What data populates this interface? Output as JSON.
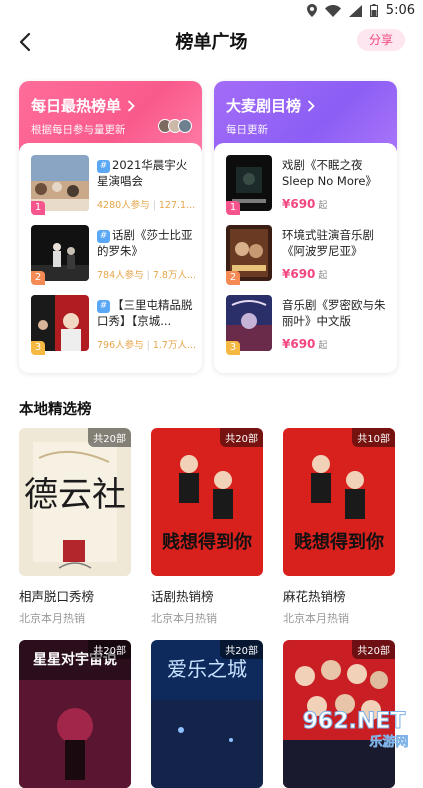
{
  "status_bar": {
    "time": "5:06"
  },
  "header": {
    "title": "榜单广场",
    "share_label": "分享"
  },
  "daily_hot": {
    "title": "每日最热榜单",
    "subtitle": "根据每日参与量更新",
    "items": [
      {
        "rank": "1",
        "name": "2021华晨宇火星演唱会",
        "participants": "4280人参与",
        "extra": "127.1..."
      },
      {
        "rank": "2",
        "name": "话剧《莎士比亚的罗朱》",
        "participants": "784人参与",
        "extra": "7.8万人..."
      },
      {
        "rank": "3",
        "name": "【三里屯精品脱口秀】【京城...",
        "participants": "796人参与",
        "extra": "1.7万人..."
      }
    ]
  },
  "musical": {
    "title": "大麦剧目榜",
    "subtitle": "每日更新",
    "items": [
      {
        "rank": "1",
        "name": "戏剧《不眠之夜Sleep No More》",
        "price": "¥690",
        "unit": "起"
      },
      {
        "rank": "2",
        "name": "环境式驻演音乐剧《阿波罗尼亚》",
        "price": "¥690",
        "unit": "起"
      },
      {
        "rank": "3",
        "name": "音乐剧《罗密欧与朱丽叶》中文版",
        "price": "¥690",
        "unit": "起"
      }
    ]
  },
  "local": {
    "title": "本地精选榜",
    "items": [
      {
        "count": "共20部",
        "name": "相声脱口秀榜",
        "sub": "北京本月热销"
      },
      {
        "count": "共20部",
        "name": "话剧热销榜",
        "sub": "北京本月热销"
      },
      {
        "count": "共10部",
        "name": "麻花热销榜",
        "sub": "北京本月热销"
      },
      {
        "count": "共20部",
        "name": "",
        "sub": ""
      },
      {
        "count": "共20部",
        "name": "",
        "sub": ""
      },
      {
        "count": "共20部",
        "name": "",
        "sub": ""
      }
    ]
  },
  "poster_text": {
    "p1": "德云社",
    "p2": "贱想得到你",
    "p3": "贱想得到你",
    "p4": "星星对宇宙说",
    "p5": "爱乐之城"
  },
  "watermark": {
    "brand": "962.NET",
    "sub": "乐游网"
  },
  "colors": {
    "accent_pink": "#f2467e",
    "daily_gradient": "#ff6d9a",
    "musical_gradient": "#9a66f6",
    "meta_orange": "#e6a54a"
  }
}
